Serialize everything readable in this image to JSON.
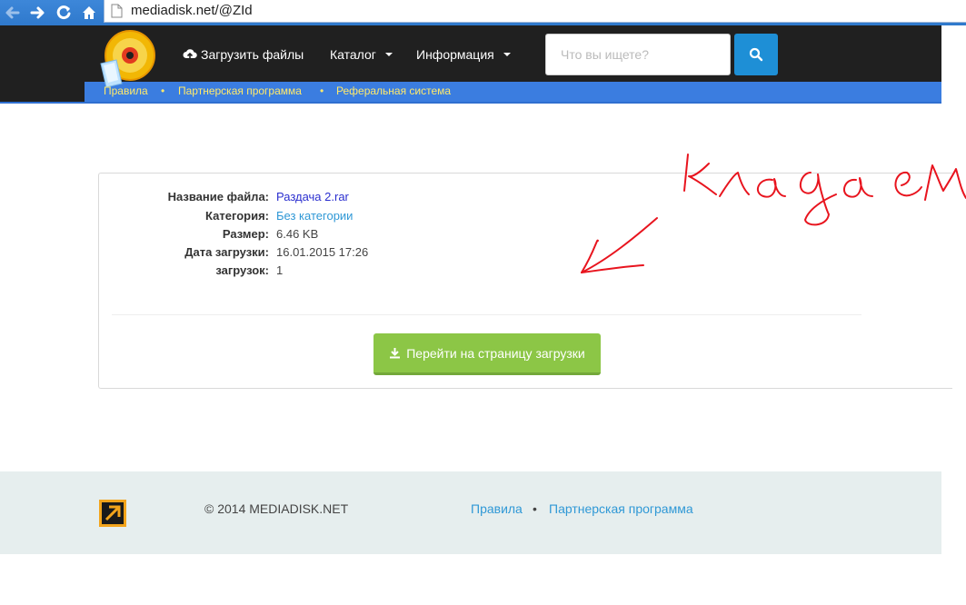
{
  "browser": {
    "url": "mediadisk.net/@ZId"
  },
  "header": {
    "upload_label": "Загрузить файлы",
    "catalog_label": "Каталог",
    "info_label": "Информация",
    "search_placeholder": "Что вы ищете?"
  },
  "subnav": {
    "items": [
      "Правила",
      "Партнерская программа",
      "Реферальная система"
    ],
    "separator": "•"
  },
  "file_info": {
    "rows": [
      {
        "label": "Название файла:",
        "value": "Раздача 2.rar"
      },
      {
        "label": "Категория:",
        "value": "Без категории"
      },
      {
        "label": "Размер:",
        "value": "6.46 KB"
      },
      {
        "label": "Дата загрузки:",
        "value": "16.01.2015 17:26"
      },
      {
        "label": "загрузок:",
        "value": "1"
      }
    ],
    "download_button_label": "Перейти на страницу загрузки"
  },
  "footer": {
    "copyright": "© 2014 MEDIADISK.NET",
    "links": [
      "Правила",
      "Партнерская программа"
    ],
    "separator": "•"
  },
  "colors": {
    "header_bg": "#202020",
    "subnav_blue": "#3b7de0",
    "subnav_link": "#ffe96b",
    "search_button": "#1e8fd6",
    "download_button": "#8cc646",
    "footer_bg": "#e6eeee",
    "annotation_red": "#e8141e"
  }
}
